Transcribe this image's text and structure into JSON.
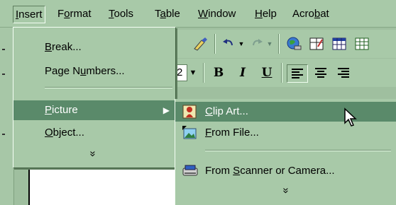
{
  "menubar": {
    "items": [
      {
        "pre": "",
        "key": "I",
        "post": "nsert",
        "active": true
      },
      {
        "pre": "F",
        "key": "o",
        "post": "rmat",
        "active": false
      },
      {
        "pre": "",
        "key": "T",
        "post": "ools",
        "active": false
      },
      {
        "pre": "T",
        "key": "a",
        "post": "ble",
        "active": false
      },
      {
        "pre": "",
        "key": "W",
        "post": "indow",
        "active": false
      },
      {
        "pre": "",
        "key": "H",
        "post": "elp",
        "active": false
      },
      {
        "pre": "Acro",
        "key": "b",
        "post": "at",
        "active": false
      }
    ]
  },
  "insert_menu": {
    "items": [
      {
        "pre": "",
        "key": "B",
        "post": "reak..."
      },
      {
        "pre": "Page N",
        "key": "u",
        "post": "mbers..."
      },
      {
        "pre": "",
        "key": "P",
        "post": "icture",
        "highlighted": true,
        "has_submenu": true
      },
      {
        "pre": "",
        "key": "O",
        "post": "bject..."
      }
    ],
    "more_glyph": "»"
  },
  "picture_submenu": {
    "items": [
      {
        "pre": "",
        "key": "C",
        "post": "lip Art...",
        "icon": "clip-art-icon",
        "highlighted": true
      },
      {
        "pre": "",
        "key": "F",
        "post": "rom File...",
        "icon": "picture-file-icon"
      },
      {
        "pre": "From ",
        "key": "S",
        "post": "canner or Camera...",
        "icon": "scanner-icon"
      }
    ],
    "more_glyph": "»"
  },
  "toolbar": {
    "font_size_value": "2",
    "bold_label": "B",
    "italic_label": "I",
    "underline_label": "U"
  },
  "colors": {
    "menu_bg": "#a8c9a8",
    "highlight": "#5a8a6a",
    "highlight_text": "#ffffff"
  }
}
